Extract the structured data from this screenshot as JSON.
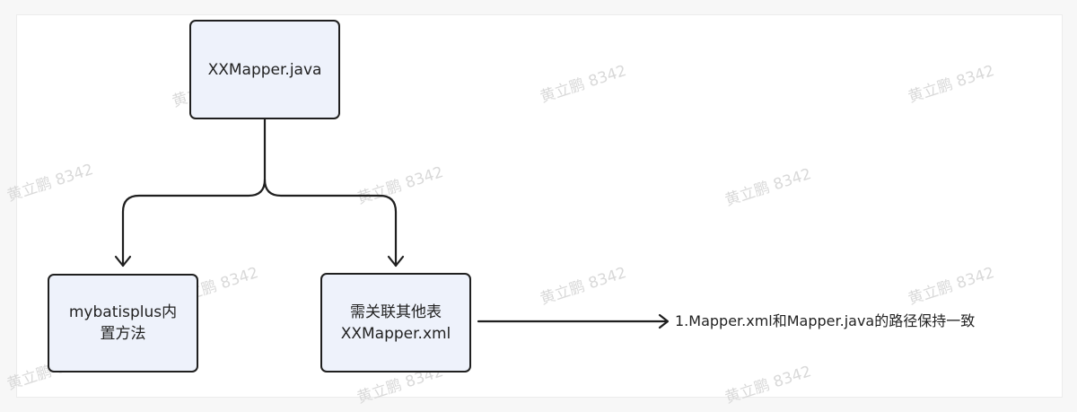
{
  "nodes": {
    "mapper_java": {
      "label": "XXMapper.java"
    },
    "builtin": {
      "line1": "mybatisplus内",
      "line2": "置方法"
    },
    "joined": {
      "line1": "需关联其他表",
      "line2": "XXMapper.xml"
    }
  },
  "note": {
    "text": "1.Mapper.xml和Mapper.java的路径保持一致"
  },
  "watermark": {
    "text": "黄立鹏 8342"
  },
  "colors": {
    "node_fill": "#eef2fb",
    "stroke": "#1f1f1f",
    "watermark": "#d9d9d9"
  }
}
